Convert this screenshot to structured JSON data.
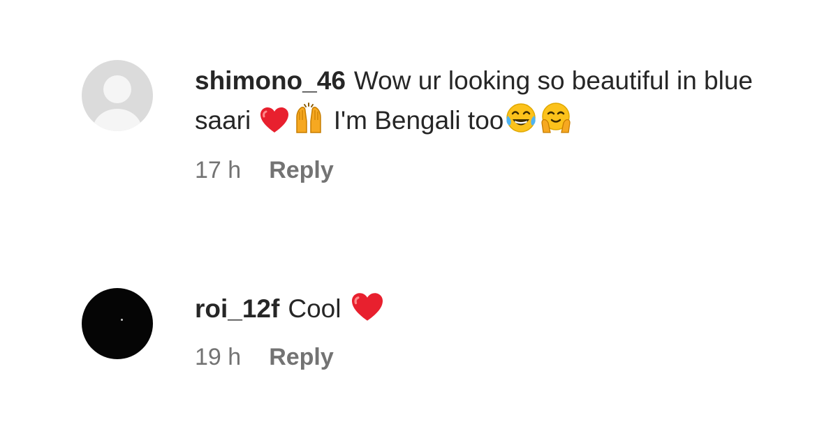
{
  "comments": [
    {
      "username": "shimono_46",
      "text_part1": "Wow ur looking so beautiful in blue saari",
      "emojis_part1": [
        "red-heart",
        "raising-hands"
      ],
      "text_part2": " I'm Bengali too",
      "emojis_part2": [
        "face-with-tears-of-joy",
        "smiling-face-with-open-hands"
      ],
      "time": "17 h",
      "reply_label": "Reply"
    },
    {
      "username": "roi_12f",
      "text_part1": "Cool",
      "emojis_part1": [
        "red-heart"
      ],
      "time": "19 h",
      "reply_label": "Reply"
    }
  ],
  "colors": {
    "primary_text": "#262626",
    "secondary_text": "#737373",
    "background": "#ffffff",
    "heart": "#e8202e"
  }
}
